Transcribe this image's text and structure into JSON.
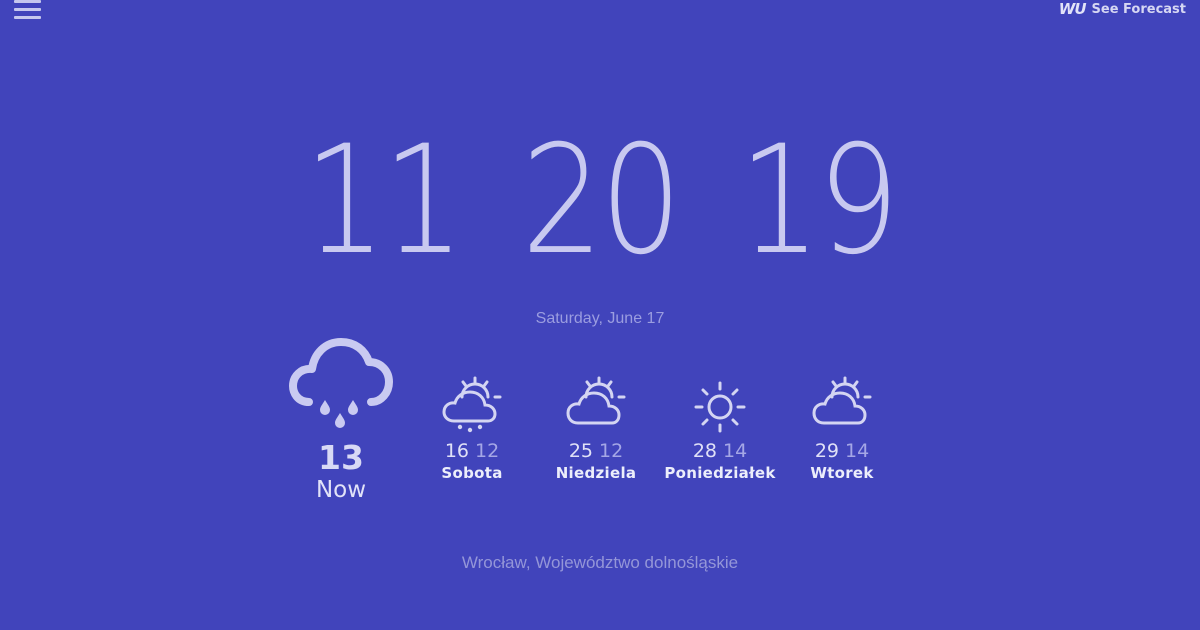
{
  "header": {
    "menu_icon": "hamburger-menu-icon",
    "brand_logo": "WU",
    "forecast_link": "See Forecast"
  },
  "clock": {
    "hours": "11",
    "minutes": "20",
    "seconds": "19"
  },
  "date": "Saturday, June 17",
  "current": {
    "icon": "rain-cloud-icon",
    "temperature": "13",
    "label": "Now"
  },
  "forecast": [
    {
      "icon": "partly-cloudy-rain-icon",
      "high": "16",
      "low": "12",
      "day": "Sobota"
    },
    {
      "icon": "partly-cloudy-icon",
      "high": "25",
      "low": "12",
      "day": "Niedziela"
    },
    {
      "icon": "sun-icon",
      "high": "28",
      "low": "14",
      "day": "Poniedziałek"
    },
    {
      "icon": "partly-cloudy-icon",
      "high": "29",
      "low": "14",
      "day": "Wtorek"
    }
  ],
  "location": "Wrocław, Województwo dolnośląskie",
  "colors": {
    "background": "#4144bb",
    "foreground": "#d4d5f2",
    "muted": "#9b9de0"
  }
}
